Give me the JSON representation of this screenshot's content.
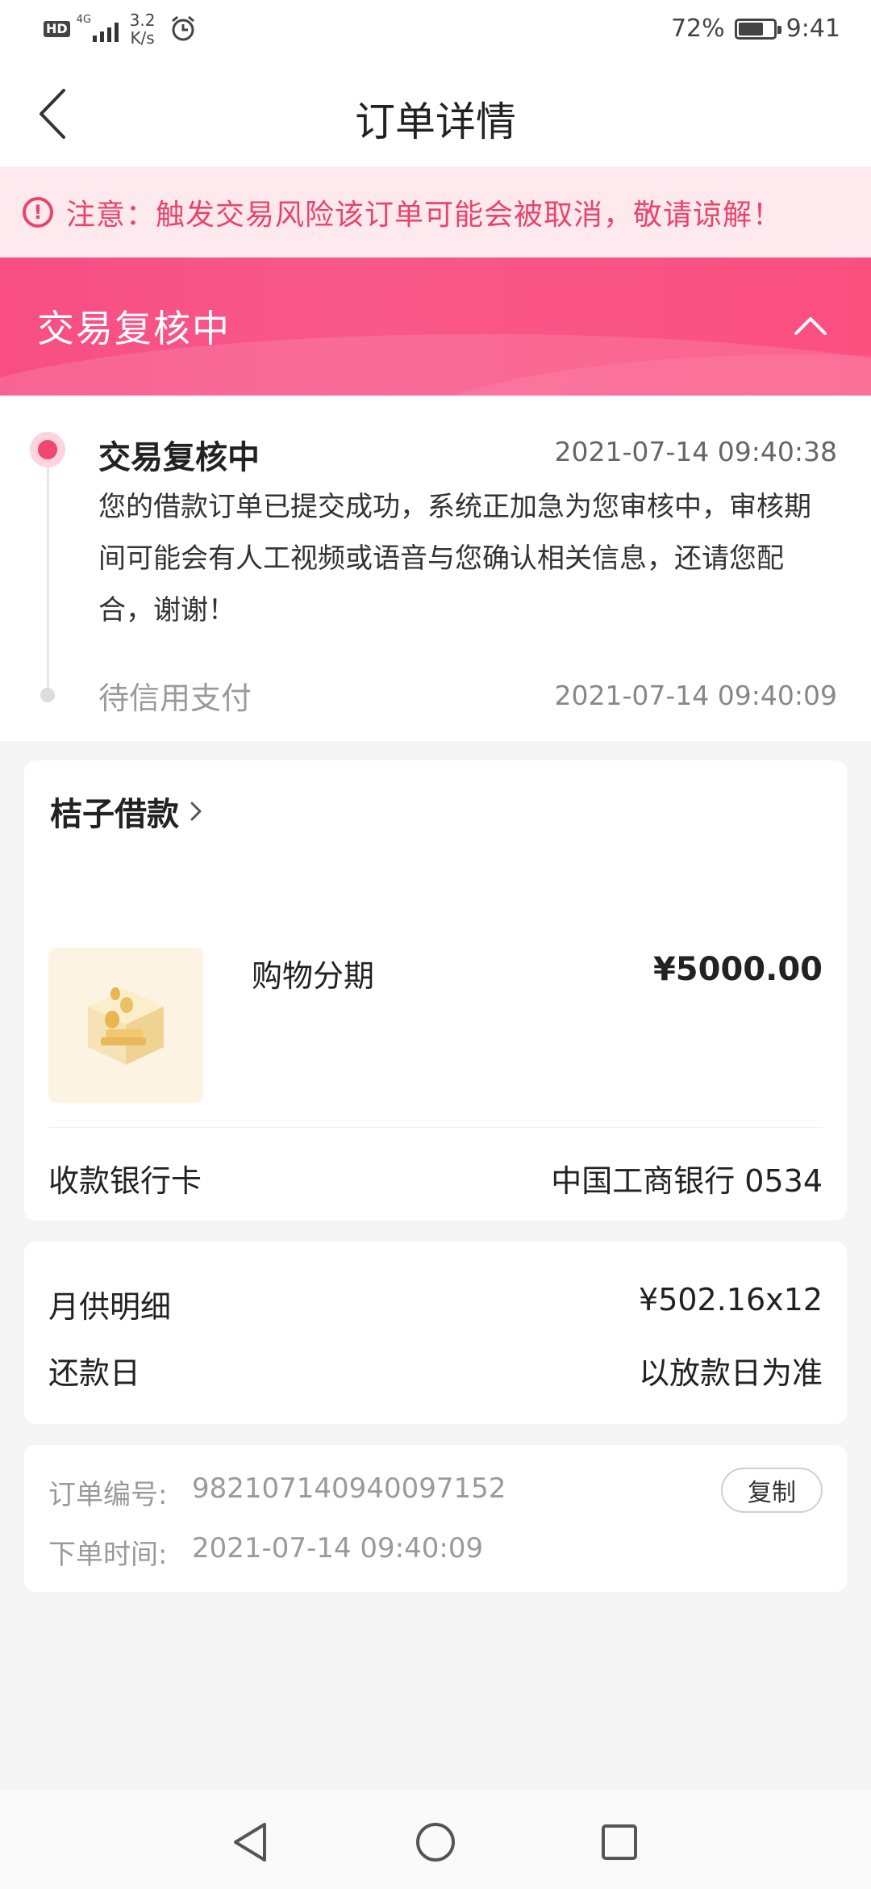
{
  "status_bar": {
    "hd_badge": "HD",
    "network": "4G",
    "speed_value": "3.2",
    "speed_unit": "K/s",
    "battery": "72%",
    "battery_level": 0.72,
    "time": "9:41"
  },
  "header": {
    "title": "订单详情"
  },
  "notice": {
    "text": "注意：触发交易风险该订单可能会被取消，敬请谅解！",
    "color": "#e8456b"
  },
  "banner": {
    "status": "交易复核中",
    "color": "#f84e84"
  },
  "timeline": [
    {
      "title": "交易复核中",
      "time": "2021-07-14 09:40:38",
      "description": "您的借款订单已提交成功，系统正加急为您审核中，审核期间可能会有人工视频或语音与您确认相关信息，还请您配合，谢谢！"
    },
    {
      "title": "待信用支付",
      "time": "2021-07-14 09:40:09"
    }
  ],
  "order_card": {
    "merchant": "桔子借款",
    "product_name": "购物分期",
    "price": "¥5000.00",
    "bank_label": "收款银行卡",
    "bank_value": "中国工商银行 0534"
  },
  "repayment_card": {
    "monthly_label": "月供明细",
    "monthly_value": "¥502.16x12",
    "due_label": "还款日",
    "due_value": "以放款日为准"
  },
  "info_card": {
    "order_no_label": "订单编号:",
    "order_no_value": "982107140940097152",
    "copy_label": "复制",
    "order_time_label": "下单时间:",
    "order_time_value": "2021-07-14 09:40:09"
  },
  "nav_icons": [
    "back-triangle-icon",
    "home-circle-icon",
    "recents-square-icon"
  ]
}
